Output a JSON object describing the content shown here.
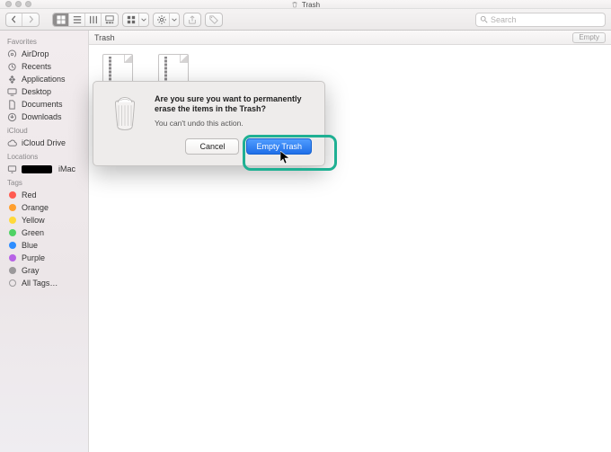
{
  "window": {
    "title": "Trash"
  },
  "toolbar": {
    "search_placeholder": "Search"
  },
  "pathbar": {
    "location": "Trash",
    "empty_label": "Empty"
  },
  "sidebar": {
    "sections": [
      {
        "title": "Favorites",
        "items": [
          {
            "label": "AirDrop",
            "icon": "airdrop"
          },
          {
            "label": "Recents",
            "icon": "recents"
          },
          {
            "label": "Applications",
            "icon": "apps"
          },
          {
            "label": "Desktop",
            "icon": "desktop"
          },
          {
            "label": "Documents",
            "icon": "documents"
          },
          {
            "label": "Downloads",
            "icon": "downloads"
          }
        ]
      },
      {
        "title": "iCloud",
        "items": [
          {
            "label": "iCloud Drive",
            "icon": "icloud"
          }
        ]
      },
      {
        "title": "Locations",
        "items": [
          {
            "label": "iMac",
            "icon": "computer",
            "redacted": true
          }
        ]
      },
      {
        "title": "Tags",
        "tags": [
          {
            "label": "Red",
            "color": "#ff5b51"
          },
          {
            "label": "Orange",
            "color": "#ff9f2e"
          },
          {
            "label": "Yellow",
            "color": "#ffd93a"
          },
          {
            "label": "Green",
            "color": "#4fd264"
          },
          {
            "label": "Blue",
            "color": "#2e8dff"
          },
          {
            "label": "Purple",
            "color": "#b763e6"
          },
          {
            "label": "Gray",
            "color": "#9b999b"
          }
        ],
        "all_tags_label": "All Tags…"
      }
    ]
  },
  "files": [
    {
      "name": "",
      "ext": "ZIP"
    },
    {
      "name": "",
      "ext": "ZIP"
    }
  ],
  "dialog": {
    "title": "Are you sure you want to permanently erase the items in the Trash?",
    "subtitle": "You can't undo this action.",
    "cancel": "Cancel",
    "confirm": "Empty Trash"
  }
}
